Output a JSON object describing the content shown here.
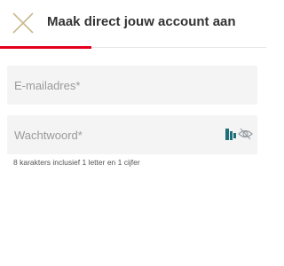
{
  "header": {
    "close_icon": "close-icon",
    "title": "Maak direct jouw account aan",
    "accent_color": "#e2001a"
  },
  "form": {
    "email": {
      "placeholder": "E-mailadres*",
      "value": ""
    },
    "password": {
      "placeholder": "Wachtwoord*",
      "value": "",
      "manager_icon": "password-manager-icon",
      "toggle_icon": "eye-slash-icon"
    },
    "password_hint": "8 karakters inclusief 1 letter en 1 cijfer"
  }
}
